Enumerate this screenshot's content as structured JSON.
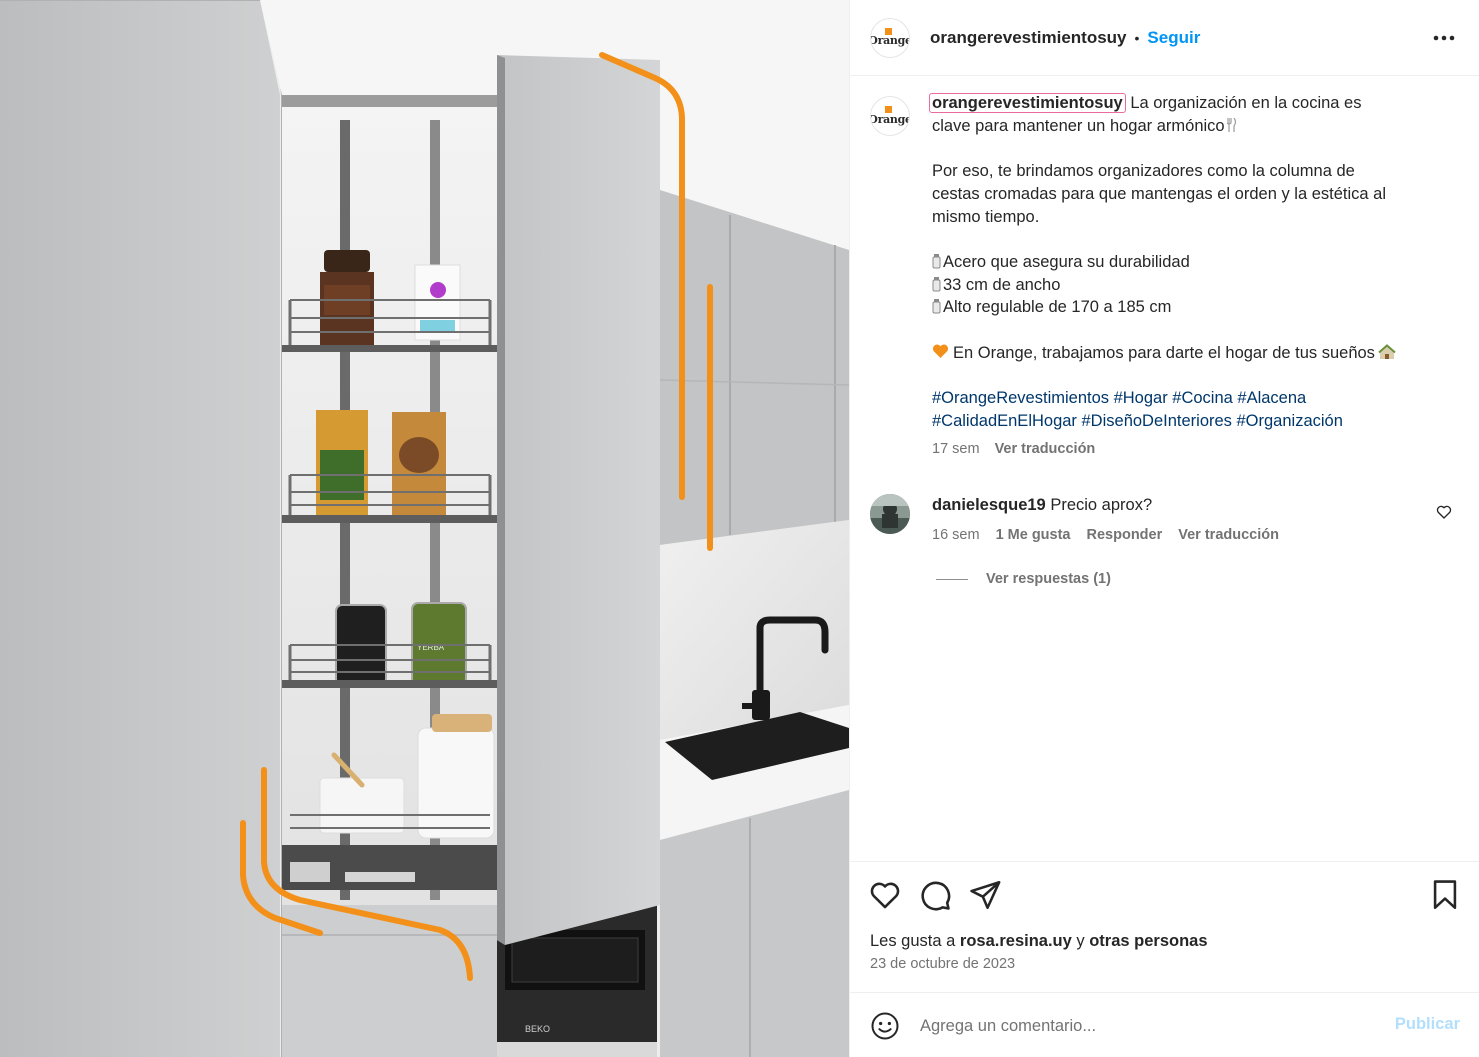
{
  "post": {
    "account": "orangerevestimientosuy",
    "separator": "•",
    "follow_label": "Seguir",
    "avatar_logo": "Orange",
    "caption": {
      "user": "orangerevestimientosuy",
      "line1": " La organización en la cocina es",
      "line2": "clave para mantener un hogar armónico",
      "para2_l1": "Por eso, te brindamos organizadores como la columna de",
      "para2_l2": "cestas cromadas para que mantengas el orden y la estética al",
      "para2_l3": "mismo tiempo.",
      "feature1": "Acero que asegura su durabilidad",
      "feature2": "33 cm de ancho",
      "feature3": "Alto regulable de 170 a 185 cm",
      "closing": "En Orange, trabajamos para darte el hogar de tus sueños",
      "hashtags_l1": "#OrangeRevestimientos #Hogar #Cocina #Alacena",
      "hashtags_l2": "#CalidadEnElHogar #DiseñoDeInteriores #Organización",
      "time": "17 sem",
      "translate": "Ver traducción"
    },
    "comments": [
      {
        "user": "danielesque19",
        "text": " Precio aprox?",
        "time": "16 sem",
        "likes": "1 Me gusta",
        "reply": "Responder",
        "translate": "Ver traducción",
        "view_replies": "Ver respuestas (1)"
      }
    ],
    "liked_by_prefix": "Les gusta a ",
    "liked_by_user": "rosa.resina.uy",
    "liked_by_and": " y ",
    "liked_by_others": "otras personas",
    "date": "23 de octubre de 2023",
    "add_comment_placeholder": "Agrega un comentario...",
    "publish_label": "Publicar"
  },
  "image": {
    "oven_brand": "BEKO",
    "jar_label": "YERBA"
  },
  "colors": {
    "accent_orange": "#f39019",
    "link_blue": "#0095f6",
    "hashtag": "#00376b",
    "muted": "#737373"
  }
}
